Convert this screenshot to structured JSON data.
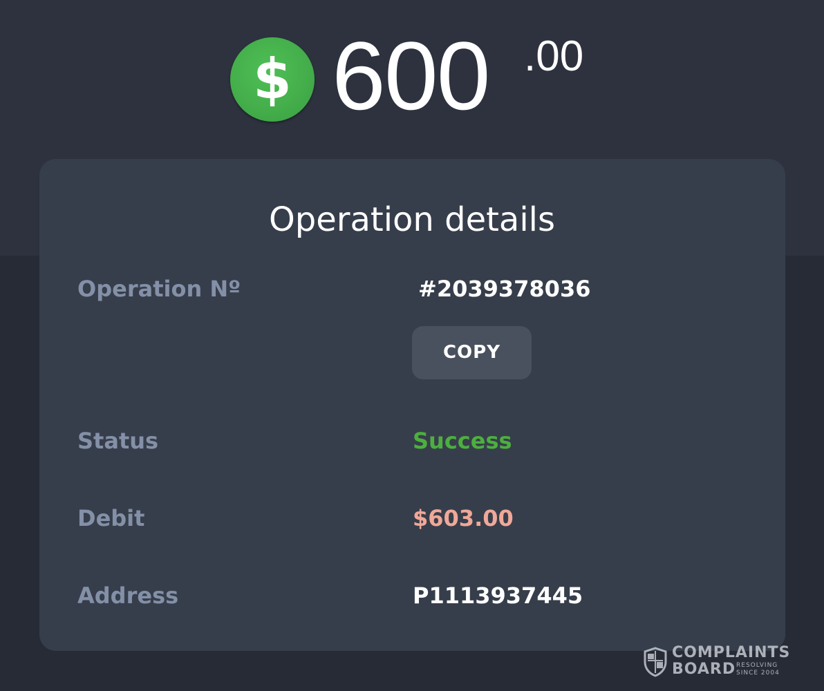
{
  "amount": {
    "currency_icon": "dollar-coin-icon",
    "currency_symbol": "$",
    "whole": "600",
    "cents": ".00",
    "icon_color": "#43ad4a"
  },
  "details": {
    "title": "Operation details",
    "operation": {
      "label": "Operation Nº",
      "value": "#2039378036",
      "copy_label": "COPY"
    },
    "status": {
      "label": "Status",
      "value": "Success",
      "color": "#4caf3f"
    },
    "debit": {
      "label": "Debit",
      "value": "$603.00",
      "color": "#f0a898"
    },
    "address": {
      "label": "Address",
      "value": "P1113937445"
    }
  },
  "watermark": {
    "line1": "COMPLAINTS",
    "line2": "BOARD",
    "sub1": "RESOLVING",
    "sub2": "SINCE 2004"
  },
  "colors": {
    "background": "#2d323e",
    "card": "#373e4b",
    "label": "#8390a7",
    "button": "#4a515e"
  }
}
